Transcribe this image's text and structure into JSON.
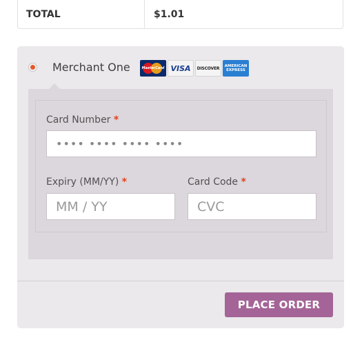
{
  "totals": {
    "label": "TOTAL",
    "value": "$1.01"
  },
  "payment": {
    "method_label": "Merchant One",
    "method_selected": true,
    "card_logos": [
      {
        "name": "mastercard-logo",
        "text": "MasterCard"
      },
      {
        "name": "visa-logo",
        "text": "VISA"
      },
      {
        "name": "discover-logo",
        "text": "DISCOVER"
      },
      {
        "name": "amex-logo",
        "text": "AMERICAN EXPRESS"
      }
    ],
    "fields": {
      "card_number": {
        "label": "Card Number",
        "required_mark": "*",
        "placeholder": "•••• •••• •••• ••••"
      },
      "expiry": {
        "label": "Expiry (MM/YY)",
        "required_mark": "*",
        "placeholder": "MM / YY"
      },
      "cvc": {
        "label": "Card Code",
        "required_mark": "*",
        "placeholder": "CVC"
      }
    }
  },
  "actions": {
    "place_order_label": "PLACE ORDER"
  },
  "colors": {
    "accent": "#a46497",
    "radio_selected": "#e55a2b",
    "required": "#e2401c",
    "panel_bg": "#ebe9eb",
    "fields_bg": "#dcd7dc"
  }
}
